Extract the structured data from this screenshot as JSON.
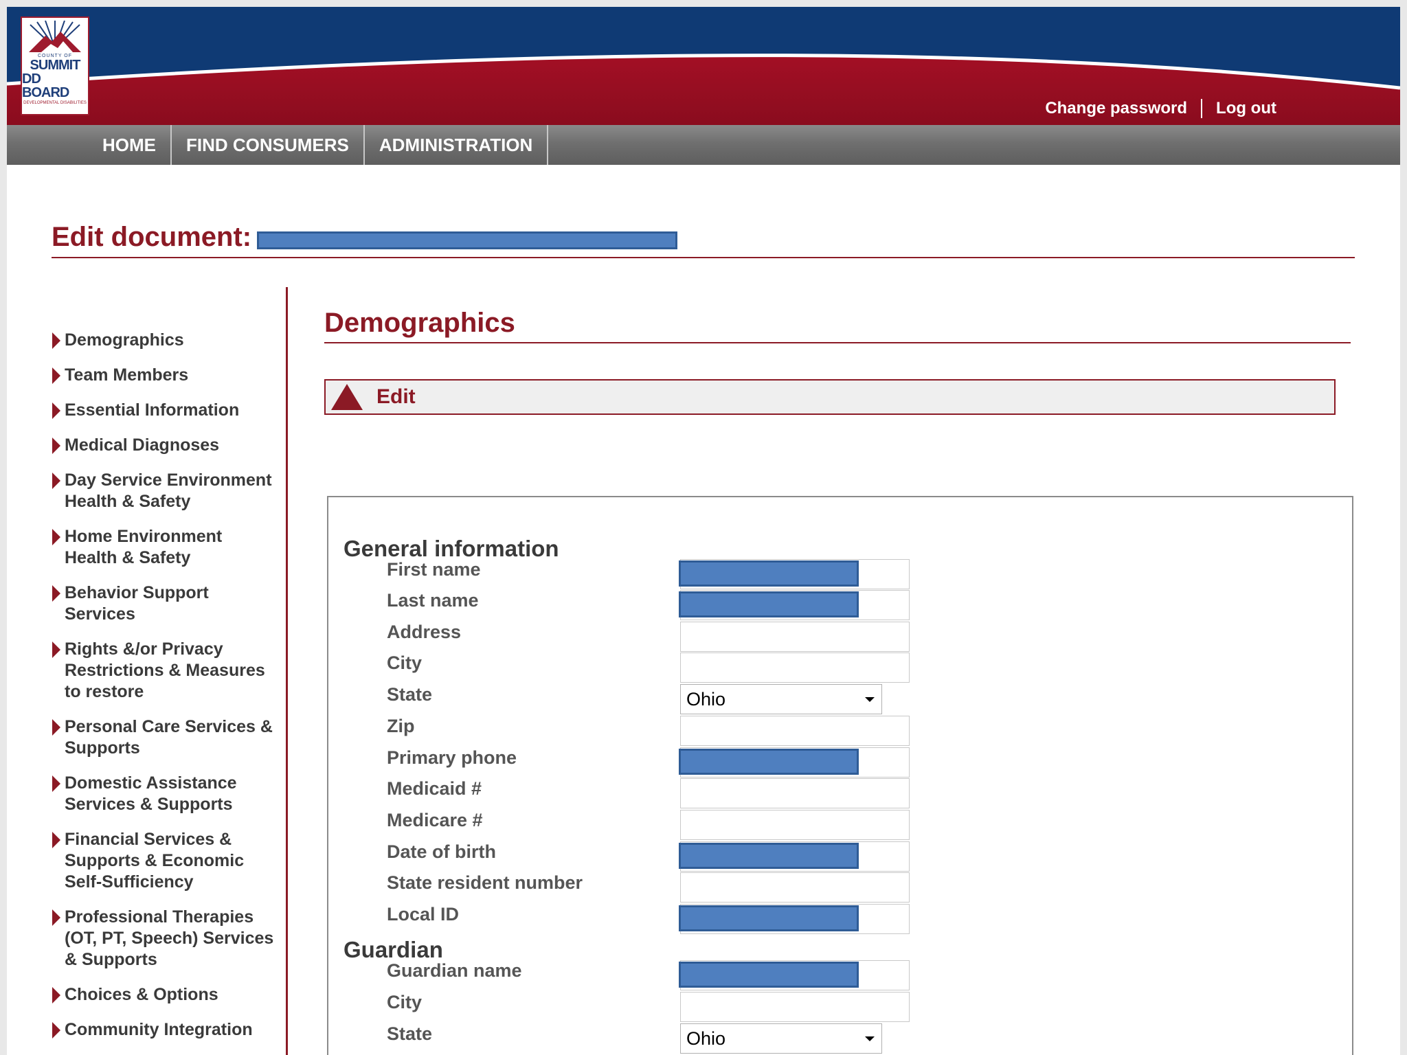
{
  "header": {
    "logo": {
      "line1": "COUNTY OF",
      "line2": "SUMMIT",
      "line3": "DD BOARD",
      "line4": "DEVELOPMENTAL DISABILITIES"
    },
    "change_password": "Change password",
    "log_out": "Log out"
  },
  "nav": {
    "home": "HOME",
    "find_consumers": "FIND CONSUMERS",
    "administration": "ADMINISTRATION"
  },
  "page_title": "Edit document:",
  "sidebar": {
    "items": [
      {
        "label": "Demographics"
      },
      {
        "label": "Team Members"
      },
      {
        "label": "Essential Information"
      },
      {
        "label": "Medical Diagnoses"
      },
      {
        "label": "Day Service Environment Health & Safety"
      },
      {
        "label": "Home Environment Health & Safety"
      },
      {
        "label": "Behavior Support Services"
      },
      {
        "label": "Rights &/or Privacy Restrictions & Measures to restore"
      },
      {
        "label": "Personal Care Services & Supports"
      },
      {
        "label": "Domestic Assistance Services & Supports"
      },
      {
        "label": "Financial Services & Supports & Economic Self-Sufficiency"
      },
      {
        "label": "Professional Therapies (OT, PT, Speech) Services & Supports"
      },
      {
        "label": "Choices & Options"
      },
      {
        "label": "Community Integration"
      }
    ]
  },
  "main": {
    "section_title": "Demographics",
    "edit_label": "Edit",
    "general": {
      "heading": "General information",
      "first_name": "First name",
      "last_name": "Last name",
      "address": "Address",
      "city": "City",
      "state": "State",
      "state_value": "Ohio",
      "zip": "Zip",
      "primary_phone": "Primary phone",
      "medicaid": "Medicaid #",
      "medicare": "Medicare #",
      "dob": "Date of birth",
      "state_resident": "State resident number",
      "local_id": "Local ID"
    },
    "guardian": {
      "heading": "Guardian",
      "name": "Guardian name",
      "city": "City",
      "state": "State",
      "state_value": "Ohio"
    }
  },
  "colors": {
    "accent": "#8b1a25",
    "navy": "#0f3a74",
    "redaction": "#4f7fbf"
  }
}
